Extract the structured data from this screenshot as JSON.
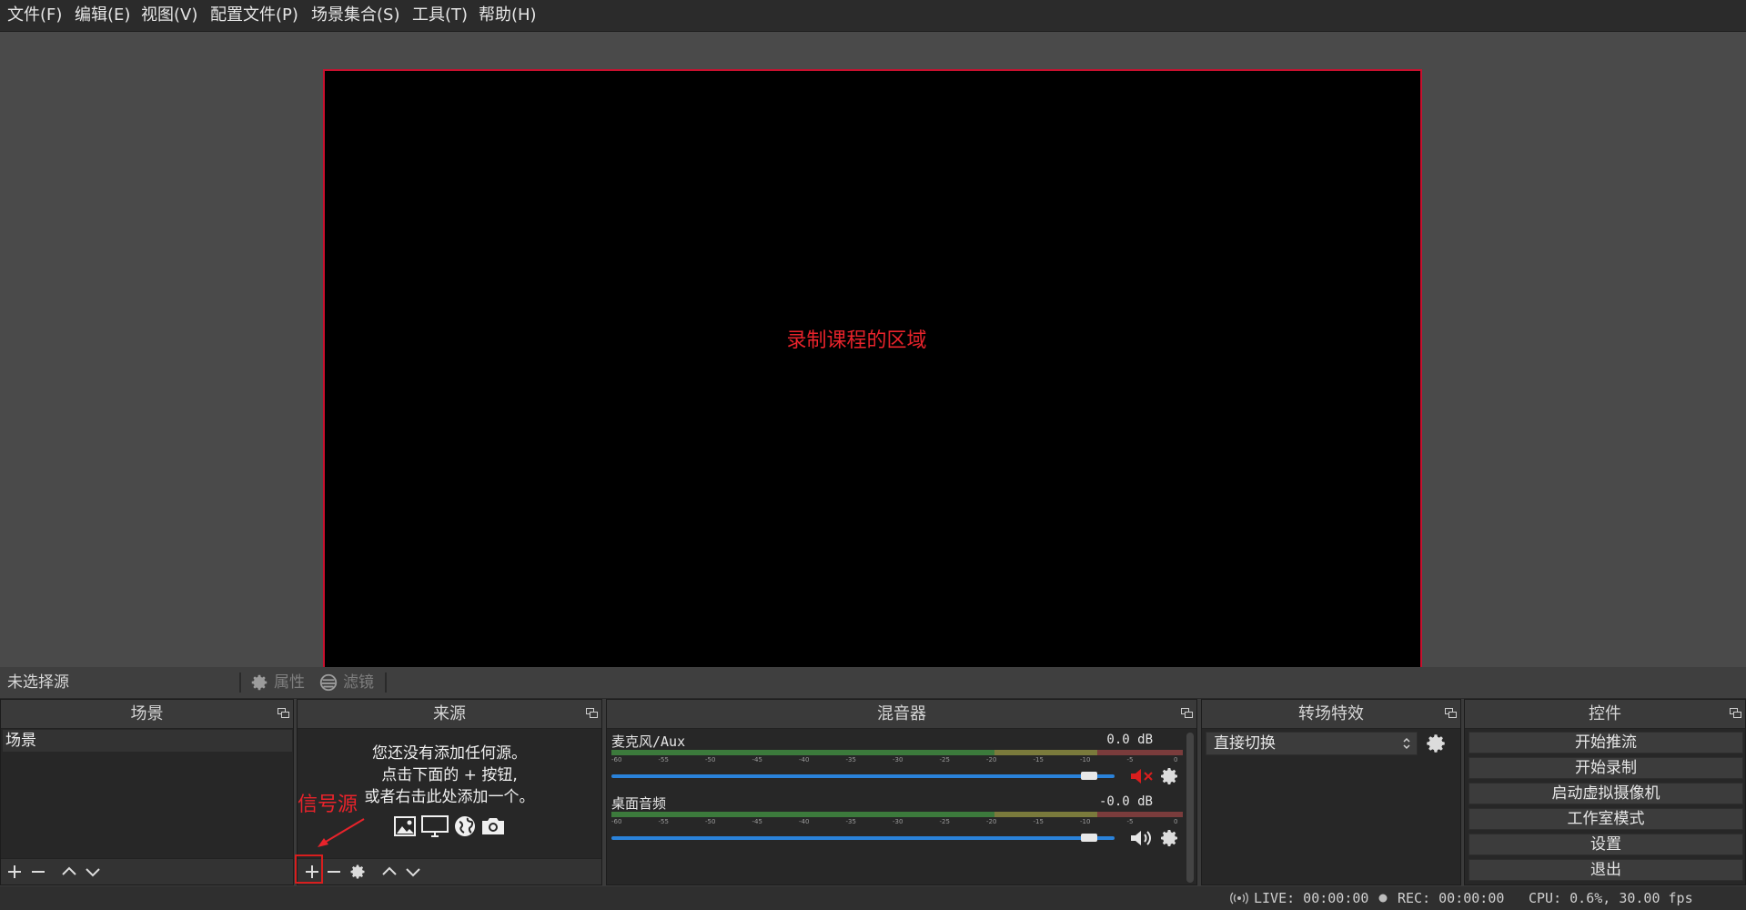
{
  "menu": {
    "items": [
      "文件(F)",
      "编辑(E)",
      "视图(V)",
      "配置文件(P)",
      "场景集合(S)",
      "工具(T)",
      "帮助(H)"
    ]
  },
  "preview": {
    "annotation": "录制课程的区域"
  },
  "source_toolbar": {
    "no_source": "未选择源",
    "properties": "属性",
    "filters": "滤镜"
  },
  "scenes": {
    "title": "场景",
    "items": [
      "场景"
    ]
  },
  "sources": {
    "title": "来源",
    "empty_lines": [
      "您还没有添加任何源。",
      "点击下面的 + 按钮,",
      "或者右击此处添加一个。"
    ],
    "annotation": "信号源"
  },
  "mixer": {
    "title": "混音器",
    "scale_labels": [
      "-60",
      "-55",
      "-50",
      "-45",
      "-40",
      "-35",
      "-30",
      "-25",
      "-20",
      "-15",
      "-10",
      "-5",
      "0"
    ],
    "channels": [
      {
        "name": "麦克风/Aux",
        "db": "0.0 dB",
        "level": 0.95,
        "muted": true
      },
      {
        "name": "桌面音频",
        "db": "-0.0 dB",
        "level": 0.95,
        "muted": false
      }
    ]
  },
  "transitions": {
    "title": "转场特效",
    "selected": "直接切换"
  },
  "controls": {
    "title": "控件",
    "buttons": [
      "开始推流",
      "开始录制",
      "启动虚拟摄像机",
      "工作室模式",
      "设置",
      "退出"
    ]
  },
  "status": {
    "live": "LIVE: 00:00:00",
    "rec": "REC: 00:00:00",
    "cpu": "CPU: 0.6%, 30.00 fps"
  },
  "colors": {
    "annotation_red": "#e8232b",
    "fader_blue": "#2a82da",
    "muted_red": "#d81e1e"
  }
}
